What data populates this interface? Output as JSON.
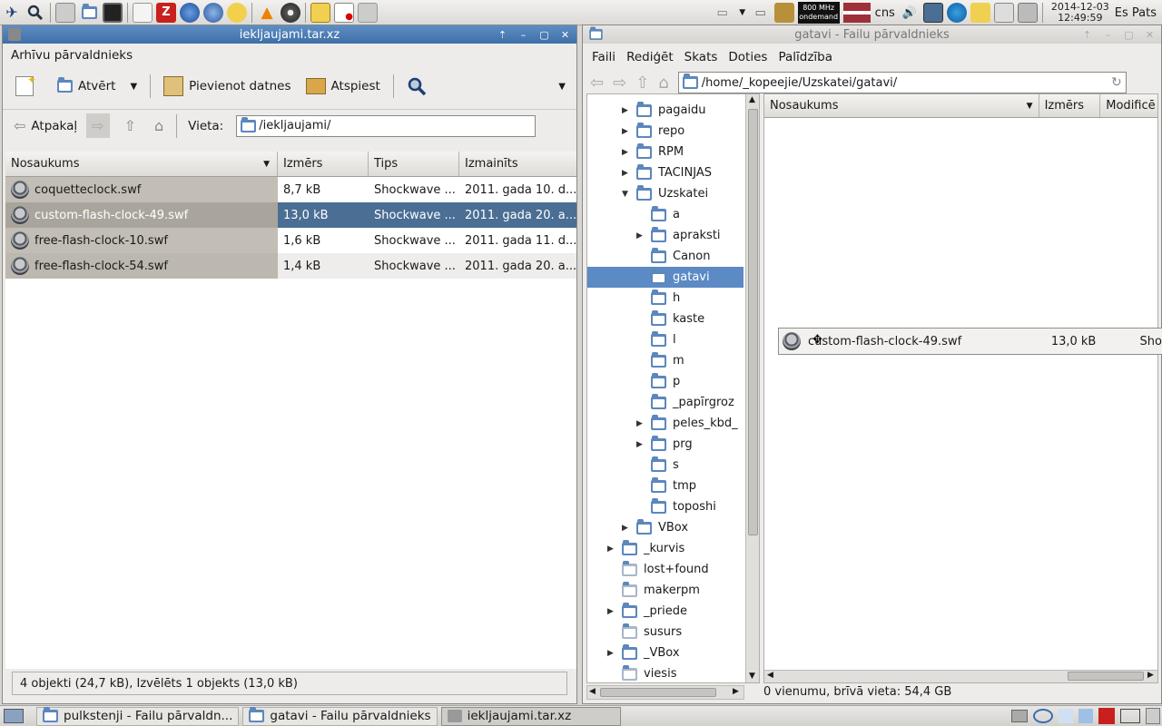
{
  "top_panel": {
    "cpu_lines": [
      "800 MHz",
      "ondemand"
    ],
    "keyboard_layout": "cns",
    "date": "2014-12-03",
    "time": "12:49:59",
    "user": "Es Pats"
  },
  "archive_window": {
    "title": "iekljaujami.tar.xz",
    "app_label": "Arhīvu pārvaldnieks",
    "toolbar": {
      "open": "Atvērt",
      "add_files": "Pievienot datnes",
      "extract": "Atspiest"
    },
    "nav": {
      "back": "Atpakaļ",
      "location_label": "Vieta:",
      "location_value": "/iekljaujami/"
    },
    "columns": [
      "Nosaukums",
      "Izmērs",
      "Tips",
      "Izmainīts"
    ],
    "files": [
      {
        "name": "coquetteclock.swf",
        "size": "8,7 kB",
        "type": "Shockwave ...",
        "modified": "2011. gada 10. d..."
      },
      {
        "name": "custom-flash-clock-49.swf",
        "size": "13,0 kB",
        "type": "Shockwave ...",
        "modified": "2011. gada 20. a..."
      },
      {
        "name": "free-flash-clock-10.swf",
        "size": "1,6 kB",
        "type": "Shockwave ...",
        "modified": "2011. gada 11. d..."
      },
      {
        "name": "free-flash-clock-54.swf",
        "size": "1,4 kB",
        "type": "Shockwave ...",
        "modified": "2011. gada 20. a..."
      }
    ],
    "status": "4 objekti (24,7 kB), Izvēlēts 1 objekts (13,0 kB)"
  },
  "fm_window": {
    "title": "gatavi - Failu pārvaldnieks",
    "menu": [
      "Faili",
      "Rediģēt",
      "Skats",
      "Doties",
      "Palīdzība"
    ],
    "path": "/home/_kopeejie/Uzskatei/gatavi/",
    "tree": [
      {
        "label": "pagaidu",
        "level": 1,
        "arrow": "right"
      },
      {
        "label": "repo",
        "level": 1,
        "arrow": "right"
      },
      {
        "label": "RPM",
        "level": 1,
        "arrow": "right"
      },
      {
        "label": "TACINJAS",
        "level": 1,
        "arrow": "right"
      },
      {
        "label": "Uzskatei",
        "level": 1,
        "arrow": "down"
      },
      {
        "label": "a",
        "level": 2,
        "arrow": ""
      },
      {
        "label": "apraksti",
        "level": 2,
        "arrow": "right"
      },
      {
        "label": "Canon",
        "level": 2,
        "arrow": ""
      },
      {
        "label": "gatavi",
        "level": 2,
        "arrow": "",
        "selected": true
      },
      {
        "label": "h",
        "level": 2,
        "arrow": ""
      },
      {
        "label": "kaste",
        "level": 2,
        "arrow": ""
      },
      {
        "label": "l",
        "level": 2,
        "arrow": ""
      },
      {
        "label": "m",
        "level": 2,
        "arrow": ""
      },
      {
        "label": "p",
        "level": 2,
        "arrow": ""
      },
      {
        "label": "_papīrgroz",
        "level": 2,
        "arrow": ""
      },
      {
        "label": "peles_kbd_",
        "level": 2,
        "arrow": "right"
      },
      {
        "label": "prg",
        "level": 2,
        "arrow": "right"
      },
      {
        "label": "s",
        "level": 2,
        "arrow": ""
      },
      {
        "label": "tmp",
        "level": 2,
        "arrow": ""
      },
      {
        "label": "toposhi",
        "level": 2,
        "arrow": ""
      },
      {
        "label": "VBox",
        "level": 1,
        "arrow": "right"
      },
      {
        "label": "_kurvis",
        "level": 0,
        "arrow": "right"
      },
      {
        "label": "lost+found",
        "level": 0,
        "arrow": "",
        "locked": true
      },
      {
        "label": "makerpm",
        "level": 0,
        "arrow": "",
        "locked": true
      },
      {
        "label": "_priede",
        "level": 0,
        "arrow": "right"
      },
      {
        "label": "susurs",
        "level": 0,
        "arrow": "",
        "locked": true
      },
      {
        "label": "_VBox",
        "level": 0,
        "arrow": "right"
      },
      {
        "label": "viesis",
        "level": 0,
        "arrow": "",
        "locked": true
      }
    ],
    "columns": [
      "Nosaukums",
      "Izmērs",
      "Modificē"
    ],
    "drag_item": {
      "name": "custom-flash-clock-49.swf",
      "size": "13,0 kB",
      "type": "Sho"
    },
    "status": "0 vienumu, brīvā vieta: 54,4 GB"
  },
  "taskbar": [
    {
      "label": "pulkstenji - Failu pārvaldn...",
      "active": false
    },
    {
      "label": "gatavi - Failu pārvaldnieks",
      "active": false
    },
    {
      "label": "iekljaujami.tar.xz",
      "active": true
    }
  ],
  "colors": {
    "titlebar_active": "#4a7bb5",
    "selection": "#4a6e94",
    "tree_selection": "#5b8ac4",
    "folder": "#5c87bd"
  }
}
